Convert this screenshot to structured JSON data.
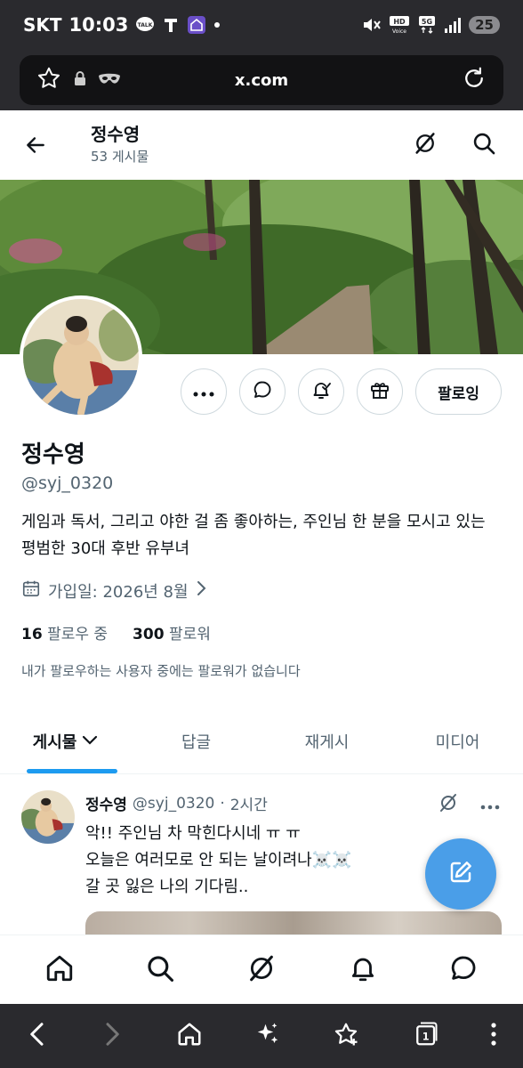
{
  "status_bar": {
    "carrier": "SKT",
    "time": "10:03",
    "battery": "25",
    "hd_label": "HD Voice",
    "network": "5G"
  },
  "browser": {
    "url": "x.com"
  },
  "header": {
    "name": "정수영",
    "post_count": "53 게시물"
  },
  "profile": {
    "name": "정수영",
    "handle": "@syj_0320",
    "bio": "게임과 독서, 그리고 야한 걸 좀 좋아하는, 주인님 한 분을 모시고 있는 평범한 30대 후반 유부녀",
    "joined": "가입일: 2026년 8월",
    "following_count": "16",
    "following_label": "팔로우 중",
    "followers_count": "300",
    "followers_label": "팔로워",
    "no_mutual": "내가 팔로우하는 사용자 중에는 팔로워가 없습니다",
    "follow_button": "팔로잉"
  },
  "tabs": [
    {
      "label": "게시물",
      "active": true
    },
    {
      "label": "답글",
      "active": false
    },
    {
      "label": "재게시",
      "active": false
    },
    {
      "label": "미디어",
      "active": false
    }
  ],
  "post": {
    "name": "정수영",
    "handle": "@syj_0320",
    "separator": "·",
    "time": "2시간",
    "text": "악!!  주인님 차 막힌다시네 ㅠ ㅠ\n오늘은 여러모로 안 되는 날이려나☠️☠️\n갈 곳 잃은 나의 기다림.."
  },
  "colors": {
    "accent": "#1d9bf0",
    "fab": "#4a9ee8",
    "chrome": "#2a2a2e"
  }
}
